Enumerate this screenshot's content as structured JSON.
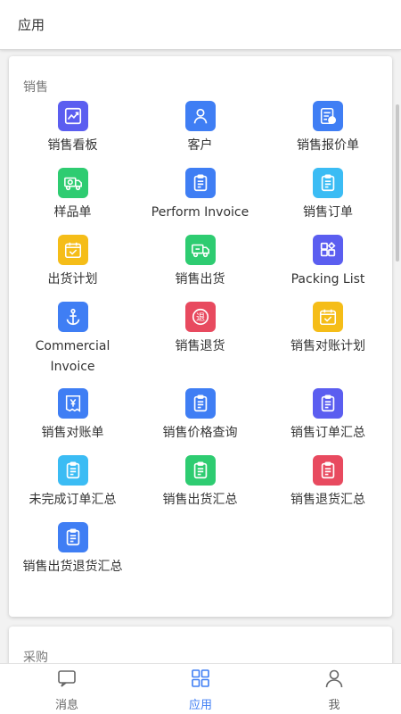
{
  "header": {
    "title": "应用"
  },
  "sales": {
    "title": "销售",
    "items": [
      {
        "label": "销售看板",
        "icon": "chart-board-icon",
        "color": "#5b5ef0"
      },
      {
        "label": "客户",
        "icon": "person-icon",
        "color": "#3f7ef4"
      },
      {
        "label": "销售报价单",
        "icon": "quote-doc-icon",
        "color": "#3f7ef4"
      },
      {
        "label": "样品单",
        "icon": "sample-truck-icon",
        "color": "#2ecc71"
      },
      {
        "label": "Perform Invoice",
        "icon": "clipboard-icon",
        "color": "#3f7ef4"
      },
      {
        "label": "销售订单",
        "icon": "clipboard-icon",
        "color": "#3bbcf4"
      },
      {
        "label": "出货计划",
        "icon": "calendar-check-icon",
        "color": "#f5bd18"
      },
      {
        "label": "销售出货",
        "icon": "delivery-truck-icon",
        "color": "#2ecc71"
      },
      {
        "label": "Packing List",
        "icon": "apps-grid-icon",
        "color": "#5b5ef0"
      },
      {
        "label": "Commercial Invoice",
        "icon": "anchor-icon",
        "color": "#3f7ef4"
      },
      {
        "label": "销售退货",
        "icon": "return-badge-icon",
        "color": "#e84a5f"
      },
      {
        "label": "销售对账计划",
        "icon": "calendar-check-icon",
        "color": "#f5bd18"
      },
      {
        "label": "销售对账单",
        "icon": "bill-doc-icon",
        "color": "#3f7ef4"
      },
      {
        "label": "销售价格查询",
        "icon": "clipboard-icon",
        "color": "#3f7ef4"
      },
      {
        "label": "销售订单汇总",
        "icon": "clipboard-icon",
        "color": "#5b5ef0"
      },
      {
        "label": "未完成订单汇总",
        "icon": "clipboard-icon",
        "color": "#3bbcf4"
      },
      {
        "label": "销售出货汇总",
        "icon": "clipboard-icon",
        "color": "#2ecc71"
      },
      {
        "label": "销售退货汇总",
        "icon": "clipboard-icon",
        "color": "#e84a5f"
      },
      {
        "label": "销售出货退货汇总",
        "icon": "clipboard-icon",
        "color": "#3f7ef4"
      }
    ]
  },
  "purchase": {
    "title": "采购"
  },
  "tabbar": [
    {
      "label": "消息",
      "icon": "message-icon",
      "active": false
    },
    {
      "label": "应用",
      "icon": "apps-icon",
      "active": true
    },
    {
      "label": "我",
      "icon": "user-icon",
      "active": false
    }
  ],
  "colors": {
    "accent": "#3f7ef4",
    "inactive": "#666666"
  }
}
